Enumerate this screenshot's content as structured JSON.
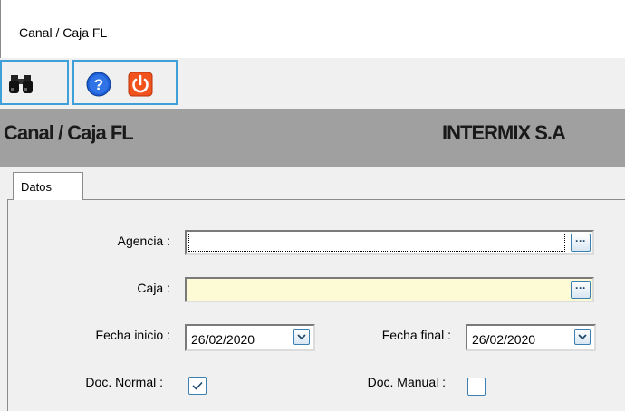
{
  "window": {
    "title": "Canal / Caja FL"
  },
  "toolbar": {
    "buttons": [
      {
        "name": "search",
        "icon": "binoculars-icon"
      },
      {
        "name": "help",
        "icon": "help-icon"
      },
      {
        "name": "exit",
        "icon": "power-icon"
      }
    ]
  },
  "header": {
    "title": "Canal / Caja FL",
    "company": "INTERMIX S.A"
  },
  "tabs": [
    {
      "label": "Datos"
    }
  ],
  "form": {
    "agencia": {
      "label": "Agencia :",
      "value": ""
    },
    "caja": {
      "label": "Caja :",
      "value": ""
    },
    "fecha_inicio": {
      "label": "Fecha inicio :",
      "value": "26/02/2020"
    },
    "fecha_final": {
      "label": "Fecha final :",
      "value": "26/02/2020"
    },
    "doc_normal": {
      "label": "Doc. Normal :",
      "checked": true
    },
    "doc_manual": {
      "label": "Doc. Manual :",
      "checked": false
    }
  },
  "colors": {
    "accent": "#3f9fd8",
    "band": "#a0a0a0",
    "caja_bg": "#fdfbd6"
  }
}
